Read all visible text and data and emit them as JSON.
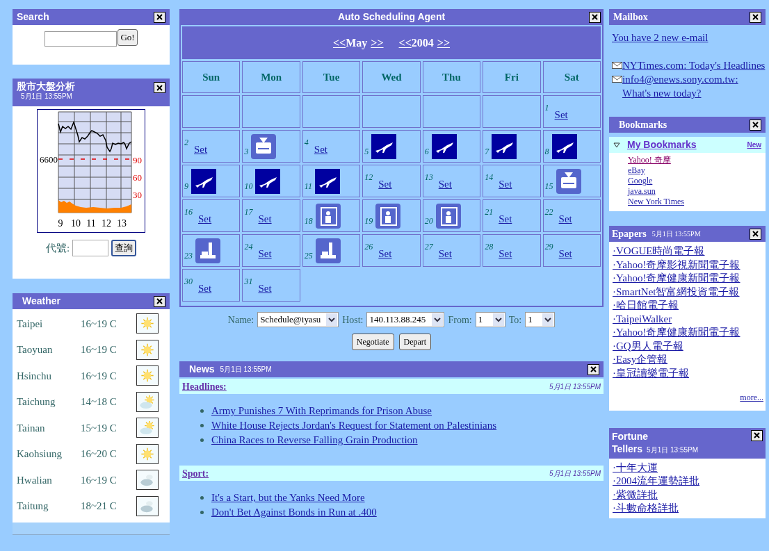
{
  "search_panel": {
    "title": "Search",
    "button": "Go!"
  },
  "stock_panel": {
    "title": "股市大盤分析",
    "timestamp": "5月1日 13:55PM",
    "chart": {
      "price_label": "6600",
      "volume_labels": [
        "90",
        "60",
        "30"
      ],
      "hour_labels": [
        "9",
        "10",
        "11",
        "12",
        "13"
      ]
    },
    "code_label": "代號:",
    "button": "查詢"
  },
  "weather_panel": {
    "title": "Weather",
    "rows": [
      {
        "city": "Taipei",
        "temp": "16~19 C",
        "kind": "sunny"
      },
      {
        "city": "Taoyuan",
        "temp": "16~19 C",
        "kind": "sunny"
      },
      {
        "city": "Hsinchu",
        "temp": "16~19 C",
        "kind": "sunny"
      },
      {
        "city": "Taichung",
        "temp": "14~18 C",
        "kind": "partly-cloudy"
      },
      {
        "city": "Tainan",
        "temp": "15~19 C",
        "kind": "partly-cloudy"
      },
      {
        "city": "Kaohsiung",
        "temp": "16~20 C",
        "kind": "sunny"
      },
      {
        "city": "Hwalian",
        "temp": "16~19 C",
        "kind": "cloudy"
      },
      {
        "city": "Taitung",
        "temp": "18~21 C",
        "kind": "cloudy"
      }
    ]
  },
  "scheduler": {
    "title": "Auto Scheduling Agent",
    "month_nav": {
      "prev": "<<",
      "label": "May",
      "next": ">>"
    },
    "year_nav": {
      "prev": "<<",
      "label": "2004",
      "next": ">>"
    },
    "weekdays": [
      "Sun",
      "Mon",
      "Tue",
      "Wed",
      "Thu",
      "Fri",
      "Sat"
    ],
    "weeks": [
      [
        {
          "kind": "blank"
        },
        {
          "kind": "blank"
        },
        {
          "kind": "blank"
        },
        {
          "kind": "blank"
        },
        {
          "kind": "blank"
        },
        {
          "kind": "blank"
        },
        {
          "kind": "set",
          "day": "1",
          "link": "Set"
        }
      ],
      [
        {
          "kind": "set",
          "day": "2",
          "link": "Set"
        },
        {
          "kind": "fax",
          "day": "3"
        },
        {
          "kind": "set",
          "day": "4",
          "link": "Set"
        },
        {
          "kind": "flight",
          "day": "5"
        },
        {
          "kind": "flight",
          "day": "6"
        },
        {
          "kind": "flight",
          "day": "7"
        },
        {
          "kind": "flight",
          "day": "8"
        }
      ],
      [
        {
          "kind": "flight",
          "day": "9"
        },
        {
          "kind": "flight",
          "day": "10"
        },
        {
          "kind": "flight",
          "day": "11"
        },
        {
          "kind": "set",
          "day": "12",
          "link": "Set"
        },
        {
          "kind": "set",
          "day": "13",
          "link": "Set"
        },
        {
          "kind": "set",
          "day": "14",
          "link": "Set"
        },
        {
          "kind": "fax",
          "day": "15"
        }
      ],
      [
        {
          "kind": "set",
          "day": "16",
          "link": "Set"
        },
        {
          "kind": "set",
          "day": "17",
          "link": "Set"
        },
        {
          "kind": "portrait",
          "day": "18"
        },
        {
          "kind": "portrait",
          "day": "19"
        },
        {
          "kind": "portrait",
          "day": "20"
        },
        {
          "kind": "set",
          "day": "21",
          "link": "Set"
        },
        {
          "kind": "set",
          "day": "22",
          "link": "Set"
        }
      ],
      [
        {
          "kind": "desk",
          "day": "23"
        },
        {
          "kind": "set",
          "day": "24",
          "link": "Set"
        },
        {
          "kind": "desk",
          "day": "25"
        },
        {
          "kind": "set",
          "day": "26",
          "link": "Set"
        },
        {
          "kind": "set",
          "day": "27",
          "link": "Set"
        },
        {
          "kind": "set",
          "day": "28",
          "link": "Set"
        },
        {
          "kind": "set",
          "day": "29",
          "link": "Set"
        }
      ],
      [
        {
          "kind": "set",
          "day": "30",
          "link": "Set"
        },
        {
          "kind": "set",
          "day": "31",
          "link": "Set"
        }
      ]
    ],
    "form": {
      "fields": [
        {
          "label": "Name:",
          "value": "Schedule@iyasu"
        },
        {
          "label": "Host:",
          "value": "140.113.88.245"
        },
        {
          "label": "From:",
          "value": "1"
        },
        {
          "label": "To:",
          "value": "1"
        }
      ],
      "buttons": [
        "Negotiate",
        "Depart"
      ]
    }
  },
  "news": {
    "title": "News",
    "timestamp": "5月1日 13:55PM",
    "sections": [
      {
        "heading": "Headlines:",
        "timestamp": "5月1日 13:55PM",
        "items": [
          "Army Punishes 7 With Reprimands for Prison Abuse",
          "White House Rejects Jordan's Request for Statement on Palestinians",
          "China Races to Reverse Falling Grain Production"
        ]
      },
      {
        "heading": "Sport:",
        "timestamp": "5月1日 13:55PM",
        "items": [
          "It's a Start, but the Yanks Need More",
          "Don't Bet Against Bonds in Run at .400"
        ]
      }
    ]
  },
  "mailbox": {
    "title": "Mailbox",
    "summary": "You have 2 new e-mail",
    "messages": [
      "NYTimes.com: Today's Headlines",
      "info4@enews.sony.com.tw: What's new today?"
    ]
  },
  "bookmarks": {
    "title": "Bookmarks",
    "folder": {
      "label": "My Bookmarks",
      "expanded": true,
      "items": [
        "Yahoo! 奇摩",
        "eBay",
        "Google",
        "java.sun",
        "New York Times"
      ]
    },
    "new_link": "New"
  },
  "epapers": {
    "title": "Epapers",
    "timestamp": "5月1日 13:55PM",
    "items": [
      "·VOGUE時尚電子報",
      "·Yahoo!奇摩影視新聞電子報",
      "·Yahoo!奇摩健康新聞電子報",
      "·SmartNet智富網投資電子報",
      "·哈日館電子報",
      "·TaipeiWalker",
      "·Yahoo!奇摩健康新聞電子報",
      "·GQ男人電子報",
      "·Easy企管報",
      "·皇冠讀樂電子報"
    ],
    "more": "more..."
  },
  "fortune": {
    "title_lines": [
      "Fortune",
      "Tellers"
    ],
    "timestamp": "5月1日 13:55PM",
    "items": [
      "·十年大運",
      "·2004流年運勢詳批",
      "·紫微詳批",
      "·斗數命格詳批"
    ]
  }
}
